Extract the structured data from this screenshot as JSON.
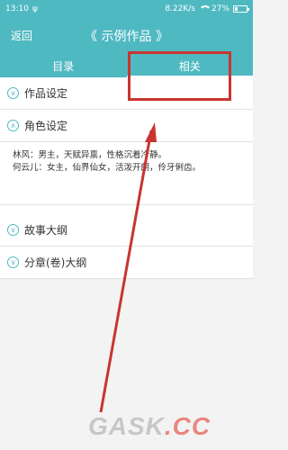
{
  "statusbar": {
    "time": "13:10",
    "net_speed": "8.22K/s",
    "battery": "27%",
    "battery_level": 0.27
  },
  "header": {
    "back": "返回",
    "title": "《 示例作品 》"
  },
  "tabs": [
    {
      "label": "目录",
      "active": false
    },
    {
      "label": "相关",
      "active": true
    }
  ],
  "sections": [
    {
      "label": "作品设定",
      "expanded": false
    },
    {
      "label": "角色设定",
      "expanded": true
    },
    {
      "label": "故事大纲",
      "expanded": false
    },
    {
      "label": "分章(卷)大纲",
      "expanded": false
    }
  ],
  "character_notes": [
    "林风：男主，天赋异禀，性格沉着冷静。",
    "何云儿：女主，仙界仙女，活泼开朗，伶牙俐齿。"
  ],
  "annotation": {
    "box_color": "#c8352f",
    "arrow_color": "#c8352f"
  },
  "watermark": {
    "text_1": "GASK",
    "text_2": ".CC"
  },
  "colors": {
    "primary": "#4fb9c2",
    "background": "#f3f3f3"
  }
}
